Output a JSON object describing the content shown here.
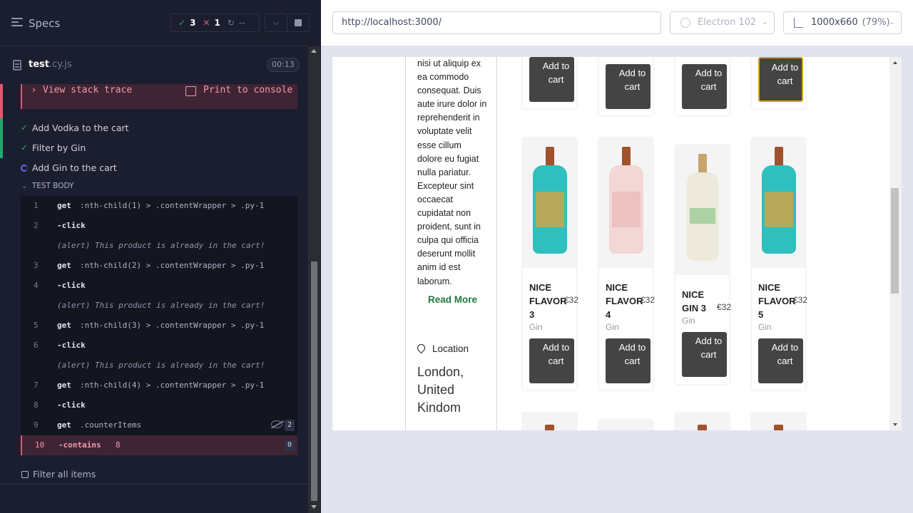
{
  "reporter": {
    "specs_label": "Specs",
    "stats": {
      "passed": "3",
      "failed": "1",
      "pending": "--"
    },
    "file": {
      "name": "test",
      "ext": ".cy.js",
      "duration": "00:13"
    },
    "error": {
      "view_stack_trace": "View stack trace",
      "print_to_console": "Print to console"
    },
    "tests": [
      {
        "label": "Add Vodka to the cart",
        "state": "passed"
      },
      {
        "label": "Filter by Gin",
        "state": "passed"
      },
      {
        "label": "Add Gin to the cart",
        "state": "running"
      }
    ],
    "test_body_label": "TEST BODY",
    "commands": [
      {
        "num": "1",
        "name": "get",
        "message": ":nth-child(1) > .contentWrapper > .py-1"
      },
      {
        "num": "2",
        "name": "-click",
        "message": ""
      },
      {
        "num": "",
        "name": "",
        "message": "(alert)  This product is already in the cart!"
      },
      {
        "num": "3",
        "name": "get",
        "message": ":nth-child(2) > .contentWrapper > .py-1"
      },
      {
        "num": "4",
        "name": "-click",
        "message": ""
      },
      {
        "num": "",
        "name": "",
        "message": "(alert)  This product is already in the cart!"
      },
      {
        "num": "5",
        "name": "get",
        "message": ":nth-child(3) > .contentWrapper > .py-1"
      },
      {
        "num": "6",
        "name": "-click",
        "message": ""
      },
      {
        "num": "",
        "name": "",
        "message": "(alert)  This product is already in the cart!"
      },
      {
        "num": "7",
        "name": "get",
        "message": ":nth-child(4) > .contentWrapper > .py-1"
      },
      {
        "num": "8",
        "name": "-click",
        "message": ""
      },
      {
        "num": "9",
        "name": "get",
        "message": ".counterItems",
        "badge": "2"
      },
      {
        "num": "10",
        "name": "-contains",
        "message": "8",
        "badge": "0",
        "state": "failed"
      }
    ],
    "filter_label": "Filter all items"
  },
  "aut": {
    "url": "http://localhost:3000/",
    "browser": "Electron 102",
    "viewport": "1000x660",
    "zoom": "(79%)",
    "sidebar": {
      "lorem": "nisi ut aliquip ex ea commodo consequat. Duis aute irure dolor in reprehenderit in voluptate velit esse cillum dolore eu fugiat nulla pariatur. Excepteur sint occaecat cupidatat non proident, sunt in culpa qui officia deserunt mollit anim id est laborum.",
      "read_more": "Read More",
      "location_label": "Location",
      "location_value": "London, United Kindom"
    },
    "button_label": "Add to cart",
    "products": [
      {
        "title": "NICE FLAVOR 3",
        "price": "€32",
        "category": "Gin",
        "bottle": "teal"
      },
      {
        "title": "NICE FLAVOR 4",
        "price": "€32",
        "category": "Gin",
        "bottle": "pink"
      },
      {
        "title": "NICE GIN 3",
        "price": "€32",
        "category": "Gin",
        "bottle": "white"
      },
      {
        "title": "NICE FLAVOR 5",
        "price": "€32",
        "category": "Gin",
        "bottle": "teal"
      }
    ],
    "colors": {
      "teal": "#2fbfbf",
      "pink": "#f3d6d6",
      "white": "#eeeadb",
      "copper": "#a0522d",
      "green": "#1e7a3c"
    }
  }
}
